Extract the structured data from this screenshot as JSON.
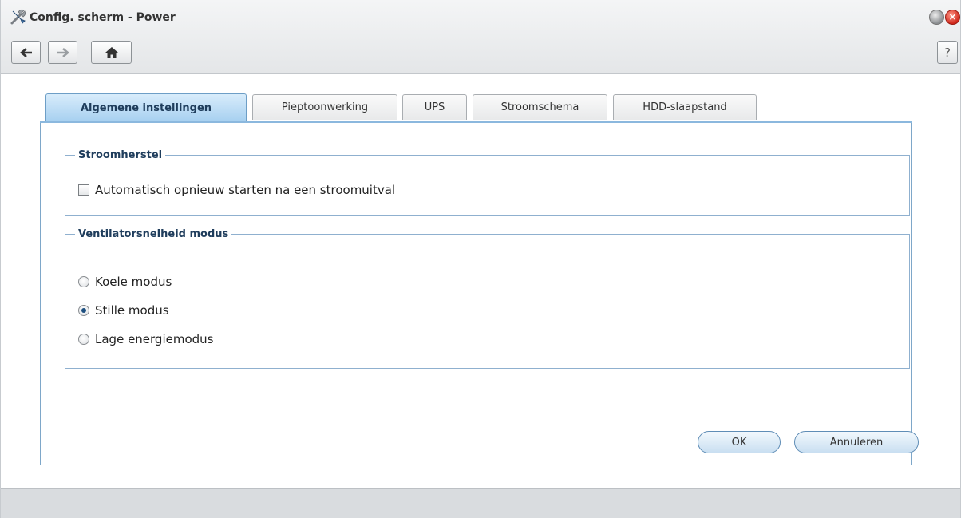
{
  "window": {
    "title": "Config. scherm - Power",
    "icon": "tools-icon",
    "controls": [
      "minimize-icon",
      "close-icon"
    ]
  },
  "toolbar": {
    "back_icon": "arrow-left-icon",
    "forward_icon": "arrow-right-icon",
    "home_icon": "home-icon",
    "help_label": "?"
  },
  "tabs": [
    {
      "label": "Algemene instellingen",
      "active": true
    },
    {
      "label": "Pieptoonwerking",
      "active": false
    },
    {
      "label": "UPS",
      "active": false
    },
    {
      "label": "Stroomschema",
      "active": false
    },
    {
      "label": "HDD-slaapstand",
      "active": false
    }
  ],
  "power_recovery": {
    "legend": "Stroomherstel",
    "auto_restart_label": "Automatisch opnieuw starten na een stroomuitval",
    "auto_restart_checked": false
  },
  "fan_speed": {
    "legend": "Ventilatorsnelheid modus",
    "options": [
      {
        "label": "Koele modus",
        "selected": false
      },
      {
        "label": "Stille modus",
        "selected": true
      },
      {
        "label": "Lage energiemodus",
        "selected": false
      }
    ]
  },
  "buttons": {
    "ok_label": "OK",
    "cancel_label": "Annuleren"
  },
  "colors": {
    "accent": "#1f3d5c",
    "tab_active": "#a7d0f0",
    "close": "#d0271b"
  }
}
